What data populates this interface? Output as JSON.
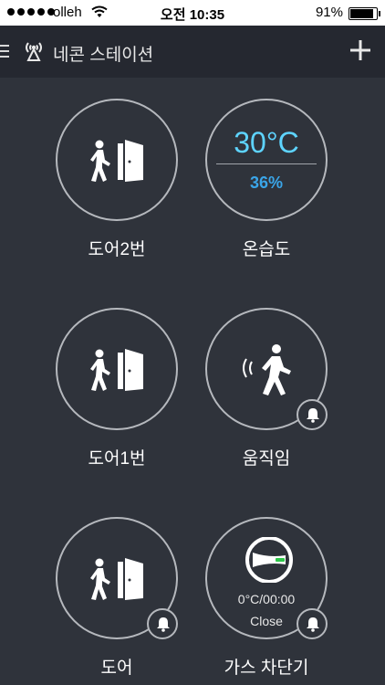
{
  "status_bar": {
    "carrier": "olleh",
    "time": "오전 10:35",
    "battery": "91%"
  },
  "nav": {
    "title": "네콘 스테이션"
  },
  "tiles": [
    {
      "label": "도어2번",
      "icon": "door-person-icon"
    },
    {
      "label": "온습도",
      "temperature": "30°C",
      "humidity": "36%"
    },
    {
      "label": "도어1번",
      "icon": "door-person-icon"
    },
    {
      "label": "움직임",
      "icon": "motion-person-icon",
      "bell": true
    },
    {
      "label": "도어",
      "icon": "door-person-icon",
      "bell": true
    },
    {
      "label": "가스 차단기",
      "icon": "gas-valve-icon",
      "reading": "0°C/00:00",
      "state": "Close",
      "bell": true
    }
  ],
  "colors": {
    "background": "#2f333b",
    "nav_background": "#252830",
    "temperature": "#5ed4ff",
    "humidity": "#3aa5e8",
    "valve_indicator": "#2ec84a"
  }
}
